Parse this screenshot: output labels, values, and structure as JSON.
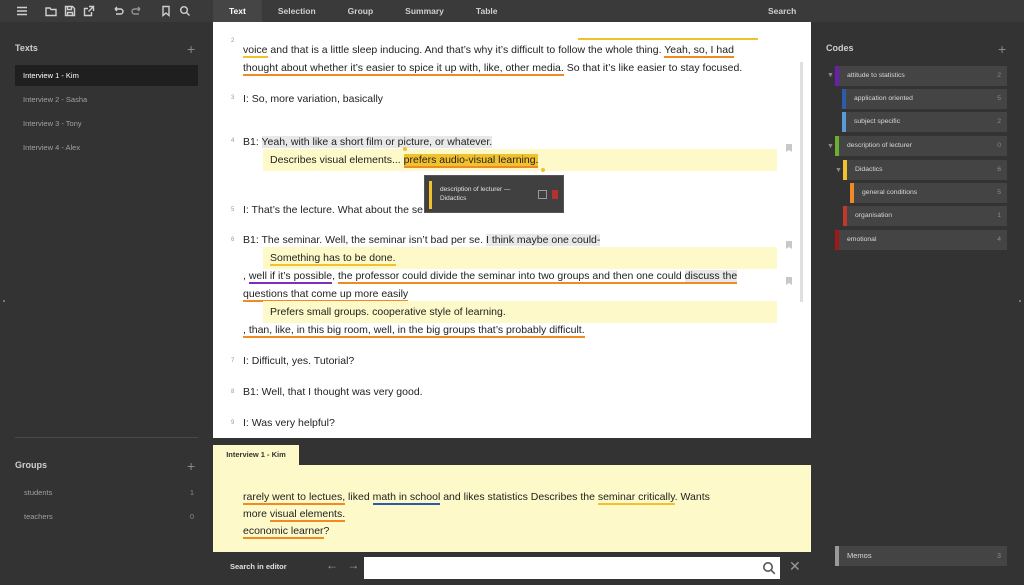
{
  "toolbar": {
    "icons": [
      "menu-icon",
      "folder-icon",
      "save-icon",
      "export-icon",
      "undo-icon",
      "redo-icon",
      "bookmark-icon",
      "search-icon"
    ],
    "tabs": [
      "Text",
      "Selection",
      "Group",
      "Summary",
      "Table"
    ],
    "active_tab": "Text",
    "search_tab": "Search"
  },
  "texts_panel": {
    "title": "Texts",
    "add": "+",
    "items": [
      "Interview 1 - Kim",
      "Interview 2 - Sasha",
      "Interview 3 - Tony",
      "Interview 4 - Alex"
    ],
    "active": "Interview 1 - Kim"
  },
  "groups_panel": {
    "title": "Groups",
    "add": "+",
    "items": [
      {
        "label": "students",
        "count": "1"
      },
      {
        "label": "teachers",
        "count": "0"
      }
    ]
  },
  "editor": {
    "p2_num": "2",
    "p2_line1_a": "voice",
    "p2_line1_b": " and that is a little sleep inducing. And that’s why it’s difficult to follow the whole thing. ",
    "p2_line1_c": "Yeah, so, I had",
    "p2_line2_a": "thought about whether it’s easier to spice it up with, like, other media.",
    "p2_line2_b": " So that it’s like easier to stay focused.",
    "p3_num": "3",
    "p3": "I: So, more variation, basically",
    "p4_num": "4",
    "p4_a": "B1: ",
    "p4_b": "Yeah, with like a short film or picture, or whatever.",
    "memo1_a": "Describes visual elements... ",
    "memo1_b": "prefers audio-visual learning.",
    "tooltip_text": "description of lecturer — Didactics",
    "p5_num": "5",
    "p5": "I: That’s the lecture. What about the se",
    "p6_num": "6",
    "p6_a": "B1: The seminar. Well, the seminar isn’t bad per se. ",
    "p6_b": "I think maybe one could-",
    "memo2": "Something has to be done.",
    "p6_line2_a": ", ",
    "p6_line2_b": "well if it’s possible",
    "p6_line2_c": ", ",
    "p6_line2_d": "the professor could divide the seminar into two groups and then one could ",
    "p6_line2_e": "discuss the",
    "p6_line3": "questions that come up more easily",
    "memo3": "Prefers small groups. cooperative style of learning.",
    "p6_line4": ", than, like, in this big room, well, in the big groups that’s probably difficult.",
    "p7_num": "7",
    "p7": "I: Difficult, yes. Tutorial?",
    "p8_num": "8",
    "p8": "B1: Well, that I thought was very good.",
    "p9_num": "9",
    "p9": "I: Was very helpful?"
  },
  "memo_pane": {
    "tab": "Interview 1 - Kim",
    "t1": "rarely went to lectues,",
    "t2": " liked ",
    "t3": "math in school",
    "t4": " and likes statistics Describes the ",
    "t5": "seminar critically",
    "t6": ". Wants",
    "t7": "more ",
    "t8": "visual elements.",
    "t9": "economic learner",
    "t10": "?"
  },
  "search_row": {
    "label": "Search in editor",
    "prev": "←",
    "next": "→",
    "value": "",
    "close": "✕"
  },
  "codes_panel": {
    "title": "Codes",
    "add": "+",
    "items": [
      {
        "label": "attitude to statistics",
        "count": "2",
        "color": "#6a1fb0"
      },
      {
        "label": "application oriented",
        "count": "5",
        "color": "#2e5aa8"
      },
      {
        "label": "subject specific",
        "count": "2",
        "color": "#5a9ad8"
      },
      {
        "label": "description of lecturer",
        "count": "0",
        "color": "#6ab02e"
      },
      {
        "label": "Didactics",
        "count": "6",
        "color": "#f2c12e"
      },
      {
        "label": "general conditions",
        "count": "5",
        "color": "#f08a24"
      },
      {
        "label": "organisation",
        "count": "1",
        "color": "#c0392b"
      },
      {
        "label": "emotional",
        "count": "4",
        "color": "#a01818"
      }
    ],
    "memos": {
      "label": "Memos",
      "count": "3"
    }
  }
}
